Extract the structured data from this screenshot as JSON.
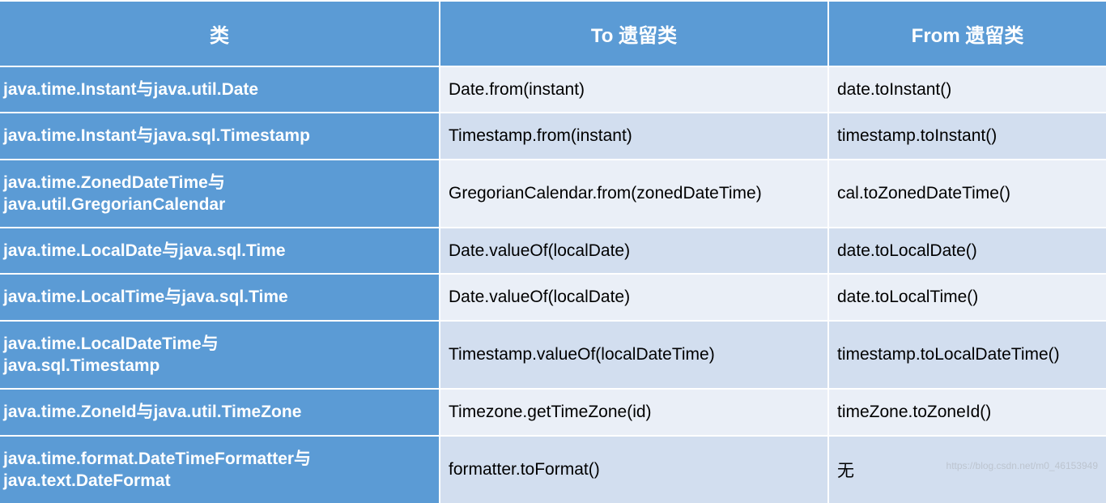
{
  "table": {
    "headers": {
      "col1": "类",
      "col2": "To 遗留类",
      "col3": "From 遗留类"
    },
    "rows": [
      {
        "class_name": "java.time.Instant与java.util.Date",
        "to_legacy": "Date.from(instant)",
        "from_legacy": "date.toInstant()"
      },
      {
        "class_name": "java.time.Instant与java.sql.Timestamp",
        "to_legacy": "Timestamp.from(instant)",
        "from_legacy": "timestamp.toInstant()"
      },
      {
        "class_name": "java.time.ZonedDateTime与\njava.util.GregorianCalendar",
        "to_legacy": "GregorianCalendar.from(zonedDateTime)",
        "from_legacy": "cal.toZonedDateTime()"
      },
      {
        "class_name": "java.time.LocalDate与java.sql.Time",
        "to_legacy": "Date.valueOf(localDate)",
        "from_legacy": "date.toLocalDate()"
      },
      {
        "class_name": "java.time.LocalTime与java.sql.Time",
        "to_legacy": "Date.valueOf(localDate)",
        "from_legacy": "date.toLocalTime()"
      },
      {
        "class_name": "java.time.LocalDateTime与\njava.sql.Timestamp",
        "to_legacy": "Timestamp.valueOf(localDateTime)",
        "from_legacy": "timestamp.toLocalDateTime()"
      },
      {
        "class_name": "java.time.ZoneId与java.util.TimeZone",
        "to_legacy": "Timezone.getTimeZone(id)",
        "from_legacy": "timeZone.toZoneId()"
      },
      {
        "class_name": "java.time.format.DateTimeFormatter与\njava.text.DateFormat",
        "to_legacy": "formatter.toFormat()",
        "from_legacy": "无"
      }
    ]
  },
  "watermark": "https://blog.csdn.net/m0_46153949"
}
